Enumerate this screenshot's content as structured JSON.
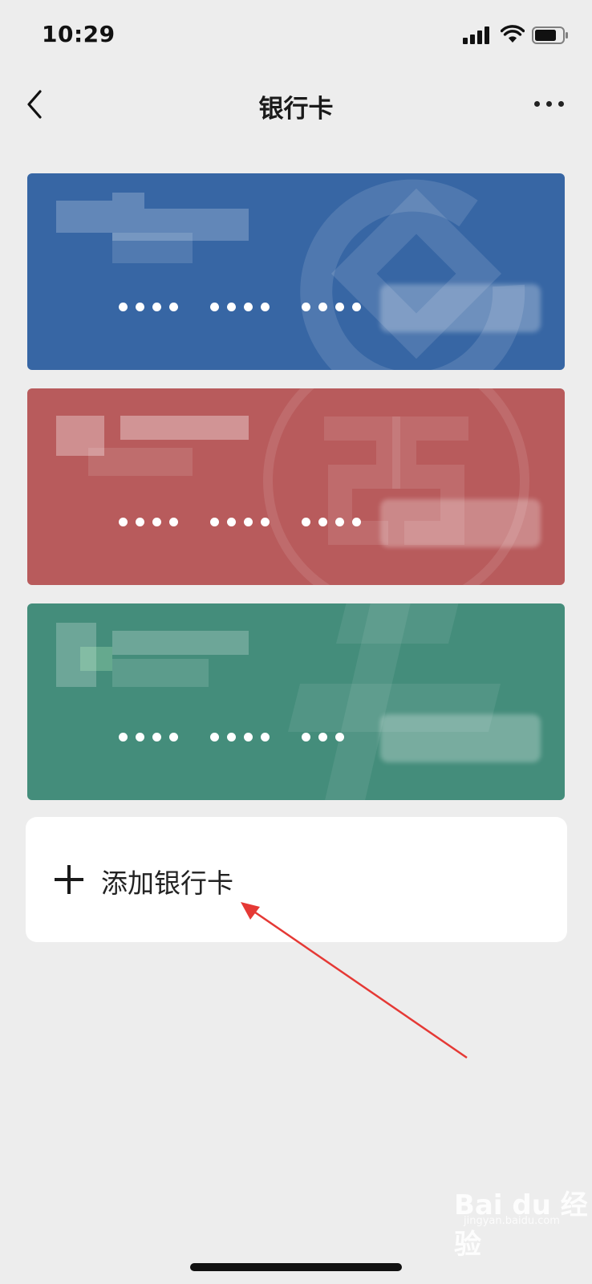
{
  "status_bar": {
    "time": "10:29"
  },
  "nav": {
    "title": "银行卡"
  },
  "cards": [
    {
      "color": "#3766a4",
      "masked_number": [
        "••••",
        "••••",
        "••••"
      ]
    },
    {
      "color": "#b85b5c",
      "masked_number": [
        "••••",
        "••••",
        "••••"
      ]
    },
    {
      "color": "#448d7b",
      "masked_number": [
        "••••",
        "••••",
        "•••"
      ]
    }
  ],
  "add_card": {
    "label": "添加银行卡",
    "icon": "plus-icon"
  },
  "watermark": {
    "text": "Bai du 经验",
    "sub": "jingyan.baidu.com"
  }
}
